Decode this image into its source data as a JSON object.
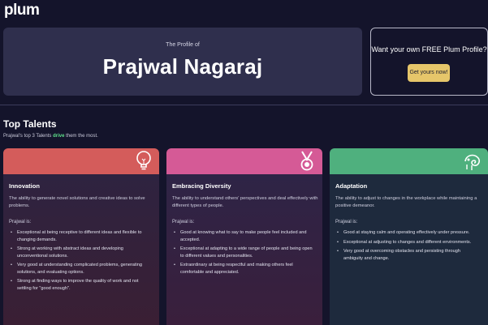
{
  "app": {
    "logo": "plum"
  },
  "hero": {
    "kicker": "The Profile of",
    "name": "Prajwal Nagaraj"
  },
  "promo": {
    "question": "Want your own FREE Plum Profile?",
    "button_label": "Get yours now!",
    "button_color": "#e6c66a"
  },
  "talents": {
    "title": "Top Talents",
    "subtitle_prefix": "Prajwal's top 3 Talents ",
    "subtitle_highlight": "drive",
    "subtitle_suffix": " them the most.",
    "cards": [
      {
        "title": "Innovation",
        "icon": "lightbulb-icon",
        "color": "#d45c5b",
        "description": "The ability to generate novel solutions and creative ideas to solve problems.",
        "is_label": "Prajwal is:",
        "points": [
          "Exceptional at being receptive to different ideas and flexible to changing demands.",
          "Strong at working with abstract ideas and developing unconventional solutions.",
          "Very good at understanding complicated problems, generating solutions, and evaluating options.",
          "Strong at finding ways to improve the quality of work and not settling for \"good enough\"."
        ]
      },
      {
        "title": "Embracing Diversity",
        "icon": "medal-icon",
        "color": "#d55a96",
        "description": "The ability to understand others' perspectives and deal effectively with different types of people.",
        "is_label": "Prajwal is:",
        "points": [
          "Good at knowing what to say to make people feel included and accepted.",
          "Exceptional at adapting to a wide range of people and being open to different values and personalities.",
          "Extraordinary at being respectful and making others feel comfortable and appreciated."
        ]
      },
      {
        "title": "Adaptation",
        "icon": "chameleon-icon",
        "color": "#4fb07e",
        "description": "The ability to adjust to changes in the workplace while maintaining a positive demeanor.",
        "is_label": "Prajwal is:",
        "points": [
          "Good at staying calm and operating effectively under pressure.",
          "Exceptional at adjusting to changes and different environments.",
          "Very good at overcoming obstacles and persisting through ambiguity and change."
        ]
      }
    ]
  }
}
